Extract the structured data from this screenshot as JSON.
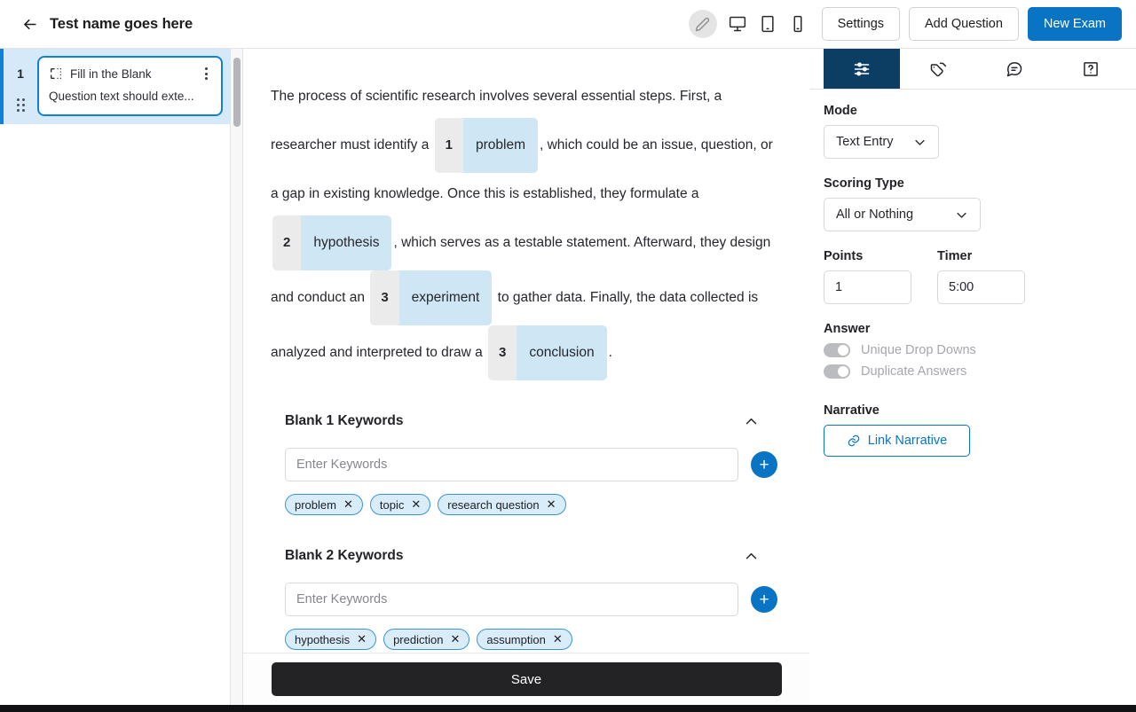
{
  "topbar": {
    "back_icon": "arrow-left-icon",
    "title": "Test name goes here",
    "edit_icon": "pencil-icon",
    "desktop_icon": "desktop-icon",
    "tablet_icon": "tablet-icon",
    "mobile_icon": "mobile-icon",
    "settings_label": "Settings",
    "add_question_label": "Add Question",
    "new_exam_label": "New Exam",
    "primary_color": "#0a74c4"
  },
  "sidebar": {
    "questions": [
      {
        "number": "1",
        "type_icon": "fill-in-the-blank-icon",
        "type_label": "Fill in the Blank",
        "menu_icon": "kebab-menu-icon",
        "preview_text": "Question text should exte...",
        "selected": true
      }
    ],
    "selected_bg": "#d6e9f8",
    "accent": "#1380d8"
  },
  "editor": {
    "passage_parts": [
      {
        "kind": "text",
        "text": "The process of scientific research involves several essential steps. First, a researcher must identify a "
      },
      {
        "kind": "blank",
        "number": "1",
        "word": "problem"
      },
      {
        "kind": "text",
        "text": ", which could be an issue, question, or a gap in existing knowledge. Once this is established, they formulate a "
      },
      {
        "kind": "blank",
        "number": "2",
        "word": "hypothesis"
      },
      {
        "kind": "text",
        "text": ", which serves as a testable statement. Afterward, they design and conduct an "
      },
      {
        "kind": "blank",
        "number": "3",
        "word": "experiment"
      },
      {
        "kind": "text",
        "text": " to gather data. Finally, the data collected is analyzed and interpreted to draw a "
      },
      {
        "kind": "blank",
        "number": "3",
        "word": "conclusion"
      },
      {
        "kind": "text",
        "text": "."
      }
    ],
    "keyword_sections": [
      {
        "title": "Blank 1 Keywords",
        "collapse_icon": "chevron-up-icon",
        "input_placeholder": "Enter Keywords",
        "input_value": "",
        "add_icon": "plus-icon",
        "chips": [
          "problem",
          "topic",
          "research question"
        ]
      },
      {
        "title": "Blank 2 Keywords",
        "collapse_icon": "chevron-up-icon",
        "input_placeholder": "Enter Keywords",
        "input_value": "",
        "add_icon": "plus-icon",
        "chips": [
          "hypothesis",
          "prediction",
          "assumption"
        ]
      }
    ],
    "save_label": "Save"
  },
  "rightpanel": {
    "tabs": [
      {
        "icon": "sliders-icon",
        "active": true
      },
      {
        "icon": "tags-icon",
        "active": false
      },
      {
        "icon": "comment-icon",
        "active": false
      },
      {
        "icon": "help-icon",
        "active": false
      }
    ],
    "active_tab_bg": "#0c3d63",
    "mode_label": "Mode",
    "mode_value": "Text Entry",
    "scoring_label": "Scoring Type",
    "scoring_value": "All or Nothing",
    "points_label": "Points",
    "points_value": "1",
    "timer_label": "Timer",
    "timer_value": "5:00",
    "answer_label": "Answer",
    "toggles": [
      {
        "label": "Unique Drop Downs",
        "on": false,
        "disabled": true
      },
      {
        "label": "Duplicate Answers",
        "on": false,
        "disabled": true
      }
    ],
    "narrative_label": "Narrative",
    "link_narrative_label": "Link Narrative",
    "link_icon": "link-icon"
  }
}
